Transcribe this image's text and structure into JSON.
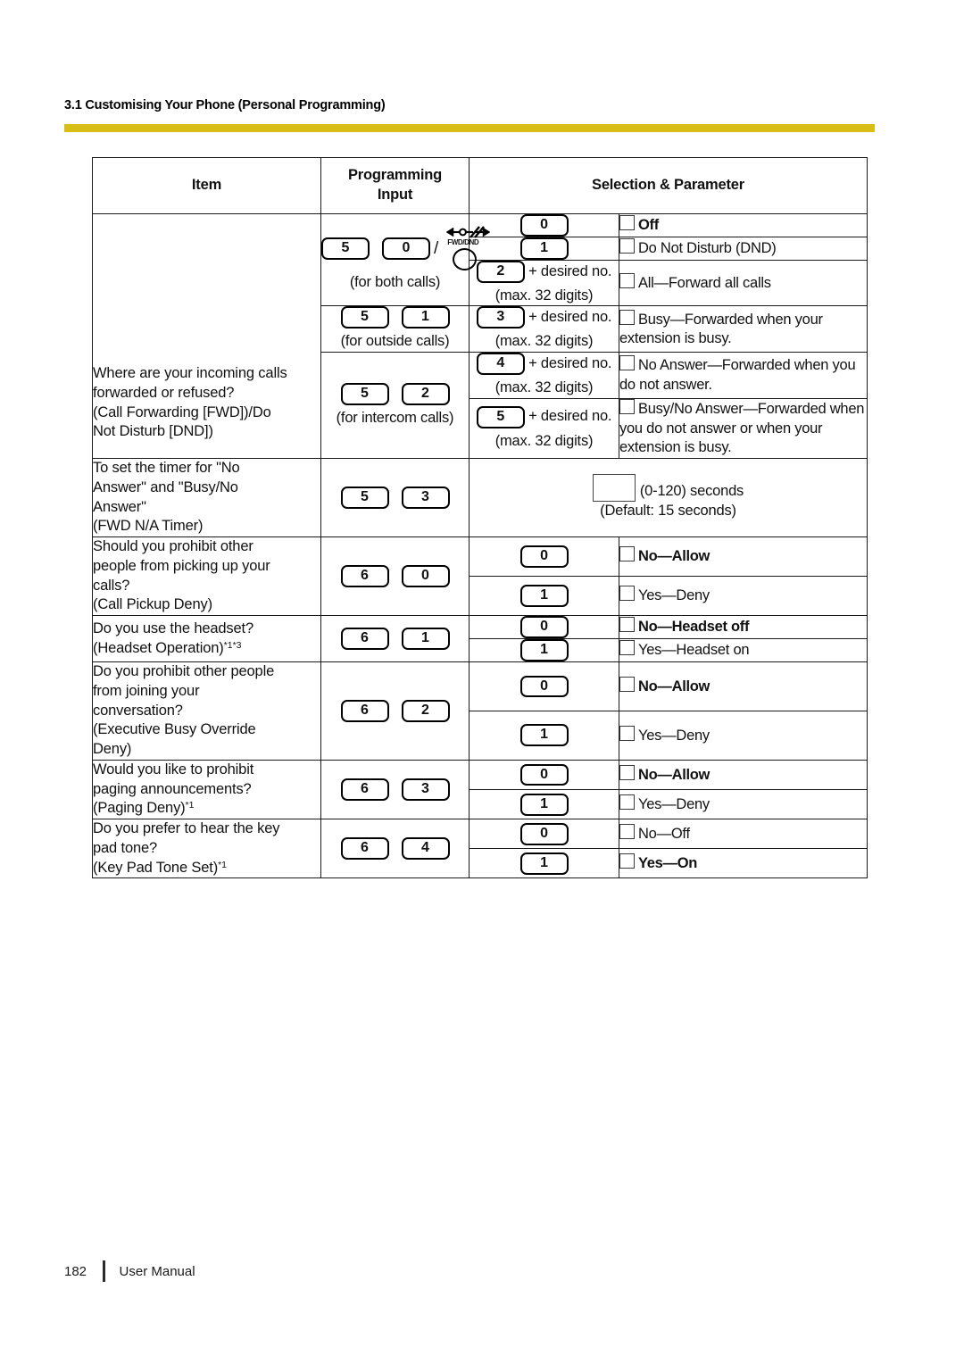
{
  "header": {
    "running_head": "3.1 Customising Your Phone (Personal Programming)",
    "rule_color": "#D9BE17"
  },
  "table": {
    "columns": {
      "item": "Item",
      "programming_input_line1": "Programming",
      "programming_input_line2": "Input",
      "selection_parameter": "Selection & Parameter"
    },
    "rows": [
      {
        "item": {
          "line1": "Where are your incoming calls",
          "line2": "forwarded or refused?",
          "line3": "(Call Forwarding [FWD])/Do",
          "line4": "Not Disturb [DND])"
        },
        "inputs": [
          {
            "keys": [
              "5",
              "0"
            ],
            "icon": "fwd-dnd-icon",
            "icon_label": "FWD/DND",
            "note": "(for both calls)"
          },
          {
            "keys": [
              "5",
              "1"
            ],
            "note": "(for outside calls)"
          },
          {
            "keys": [
              "5",
              "2"
            ],
            "note": "(for intercom calls)"
          }
        ],
        "selections": [
          {
            "key": "0",
            "suffix": "",
            "note": "",
            "param": "Off",
            "bold": true
          },
          {
            "key": "1",
            "suffix": "",
            "note": "",
            "param": "Do Not Disturb (DND)",
            "bold": false
          },
          {
            "key": "2",
            "suffix": "+ desired no.",
            "note": "(max. 32 digits)",
            "param": "All—Forward all calls",
            "bold": false
          },
          {
            "key": "3",
            "suffix": "+ desired no.",
            "note": "(max. 32 digits)",
            "param": "Busy—Forwarded when your extension is busy.",
            "bold": false
          },
          {
            "key": "4",
            "suffix": "+ desired no.",
            "note": "(max. 32 digits)",
            "param": "No Answer—Forwarded when you do not answer.",
            "bold": false
          },
          {
            "key": "5",
            "suffix": "+ desired no.",
            "note": "(max. 32 digits)",
            "param": "Busy/No Answer—Forwarded when you do not answer or when your extension is busy.",
            "bold": false
          }
        ]
      },
      {
        "item": {
          "line1": "To set the timer for \"No",
          "line2": "Answer\" and \"Busy/No",
          "line3": "Answer\"",
          "line4": "(FWD N/A Timer)"
        },
        "inputs": [
          {
            "keys": [
              "5",
              "3"
            ],
            "note": ""
          }
        ],
        "wide_param": {
          "has_blank_box": true,
          "line1": "(0-120) seconds",
          "line2": "(Default: 15 seconds)"
        }
      },
      {
        "item": {
          "line1": "Should you prohibit other",
          "line2": "people from picking up your",
          "line3": "calls?",
          "line4": "(Call Pickup Deny)"
        },
        "inputs": [
          {
            "keys": [
              "6",
              "0"
            ],
            "note": ""
          }
        ],
        "selections": [
          {
            "key": "0",
            "suffix": "",
            "note": "",
            "param": "No—Allow",
            "bold": true
          },
          {
            "key": "1",
            "suffix": "",
            "note": "",
            "param": "Yes—Deny",
            "bold": false
          }
        ]
      },
      {
        "item": {
          "line1": "Do you use the headset?",
          "line2": "(Headset Operation)",
          "line2_sup": "*1*3",
          "line3": "",
          "line4": ""
        },
        "inputs": [
          {
            "keys": [
              "6",
              "1"
            ],
            "note": ""
          }
        ],
        "selections": [
          {
            "key": "0",
            "suffix": "",
            "note": "",
            "param": "No—Headset off",
            "bold": true
          },
          {
            "key": "1",
            "suffix": "",
            "note": "",
            "param": "Yes—Headset on",
            "bold": false
          }
        ]
      },
      {
        "item": {
          "line1": "Do you prohibit other people",
          "line2": "from joining your",
          "line3": "conversation?",
          "line4": "(Executive Busy Override",
          "line5": "Deny)"
        },
        "inputs": [
          {
            "keys": [
              "6",
              "2"
            ],
            "note": ""
          }
        ],
        "selections": [
          {
            "key": "0",
            "suffix": "",
            "note": "",
            "param": "No—Allow",
            "bold": true
          },
          {
            "key": "1",
            "suffix": "",
            "note": "",
            "param": "Yes—Deny",
            "bold": false
          }
        ]
      },
      {
        "item": {
          "line1": "Would you like to prohibit",
          "line2": "paging announcements?",
          "line3": "(Paging Deny)",
          "line3_sup": "*1",
          "line4": ""
        },
        "inputs": [
          {
            "keys": [
              "6",
              "3"
            ],
            "note": ""
          }
        ],
        "selections": [
          {
            "key": "0",
            "suffix": "",
            "note": "",
            "param": "No—Allow",
            "bold": true
          },
          {
            "key": "1",
            "suffix": "",
            "note": "",
            "param": "Yes—Deny",
            "bold": false
          }
        ]
      },
      {
        "item": {
          "line1": "Do you prefer to hear the key",
          "line2": "pad tone?",
          "line3": "(Key Pad Tone Set)",
          "line3_sup": "*1",
          "line4": ""
        },
        "inputs": [
          {
            "keys": [
              "6",
              "4"
            ],
            "note": ""
          }
        ],
        "selections": [
          {
            "key": "0",
            "suffix": "",
            "note": "",
            "param": "No—Off",
            "bold": false
          },
          {
            "key": "1",
            "suffix": "",
            "note": "",
            "param": "Yes—On",
            "bold": true
          }
        ]
      }
    ]
  },
  "footer": {
    "page_number": "182",
    "label": "User Manual"
  }
}
